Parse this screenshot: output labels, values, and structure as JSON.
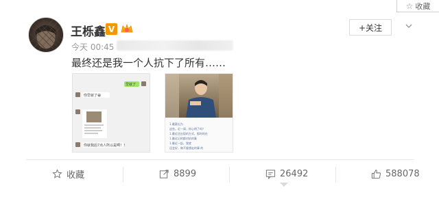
{
  "corner": {
    "label": "收藏"
  },
  "post": {
    "username": "王栎鑫",
    "verified_badge": "V",
    "follow_label": "+关注",
    "time": "今天 00:45",
    "text": "最终还是我一个人抗下了所有……"
  },
  "chat_image": {
    "bubbles": [
      "你早就了😁",
      "早就了",
      "你就我后7点人所以是啊！！"
    ]
  },
  "photo_image": {
    "lines": [
      "1.最赛出为",
      "这些。近一周，你心明了吗？",
      "1.最近还出现的方式，那时的在",
      "1.最近记的都对抗的事",
      "1.最近一起，我就",
      "还会好，做不要想走的事 的"
    ]
  },
  "actions": {
    "favorite_label": "收藏",
    "repost_count": "8899",
    "comment_count": "26492",
    "like_count": "588078"
  },
  "colors": {
    "accent_orange": "#ff8200",
    "verified_orange": "#f39800",
    "text_gray": "#999999"
  }
}
